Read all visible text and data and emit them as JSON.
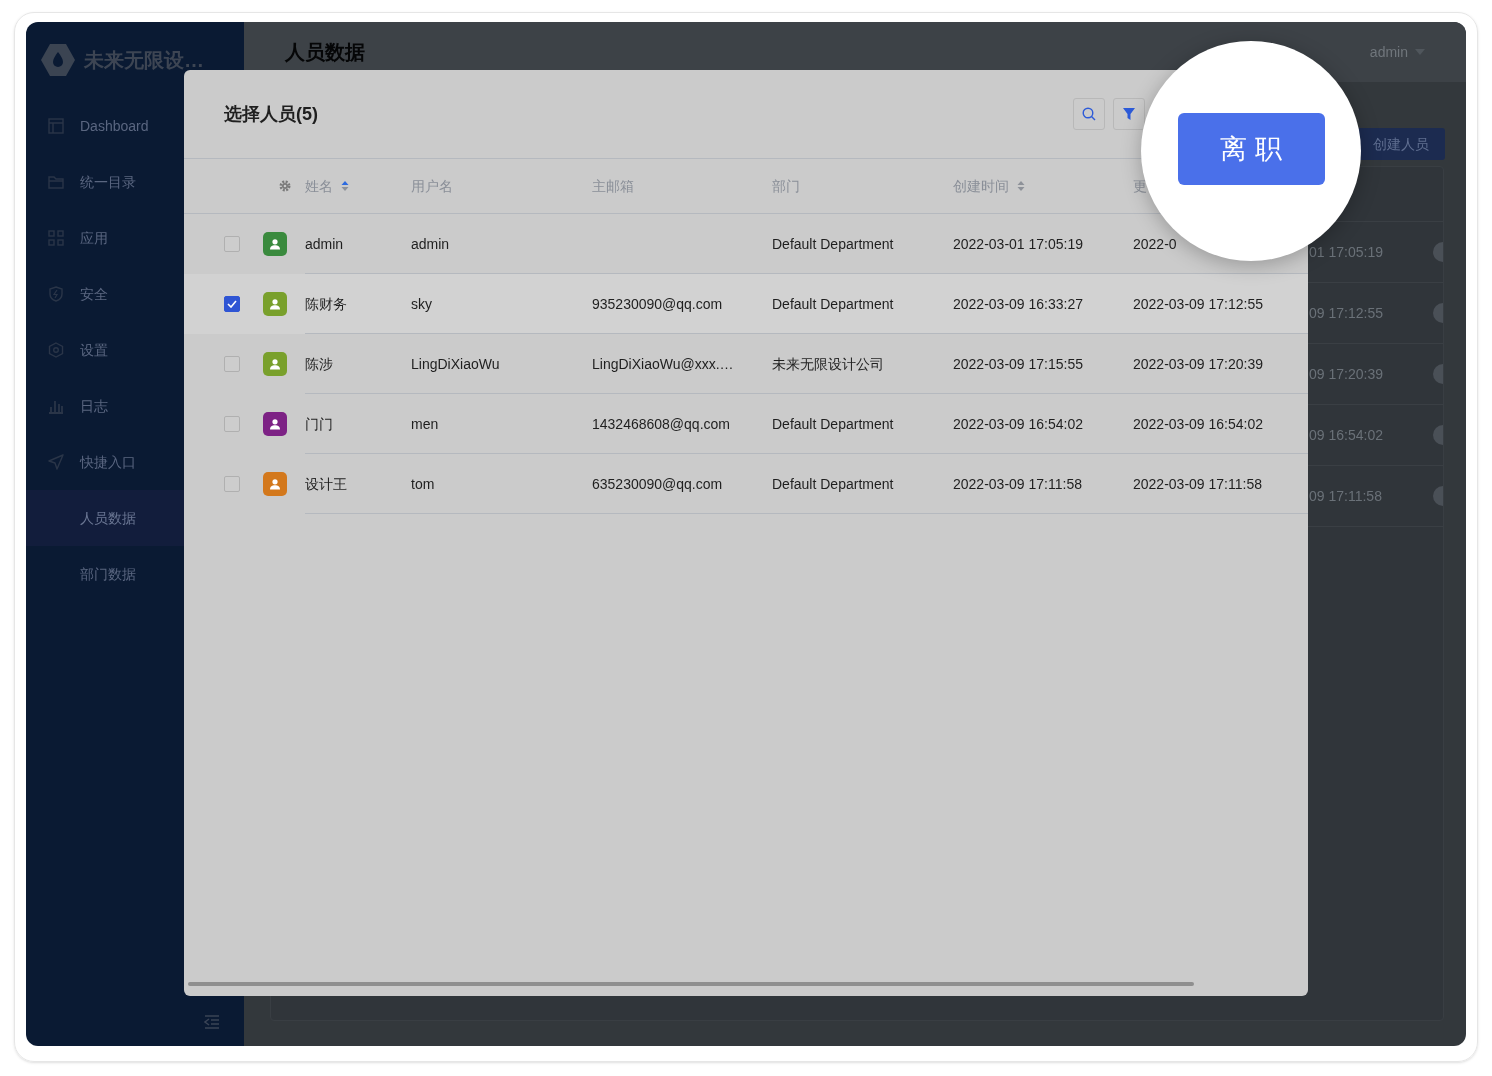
{
  "sidebar": {
    "logo_text": "未来无限设…",
    "items": [
      {
        "label": "Dashboard",
        "selected": false
      },
      {
        "label": "统一目录",
        "selected": false
      },
      {
        "label": "应用",
        "selected": false
      },
      {
        "label": "安全",
        "selected": false
      },
      {
        "label": "设置",
        "selected": false
      },
      {
        "label": "日志",
        "selected": false
      },
      {
        "label": "快捷入口",
        "selected": false,
        "children": [
          {
            "label": "人员数据",
            "selected": true
          },
          {
            "label": "部门数据",
            "selected": false
          }
        ]
      }
    ]
  },
  "page": {
    "title": "人员数据",
    "user": "admin",
    "create_button": "创建人员",
    "row_fragments": [
      "01 17:05:19",
      "09 17:12:55",
      "09 17:20:39",
      "09 16:54:02",
      "09 17:11:58"
    ]
  },
  "modal": {
    "title": "选择人员(5)",
    "columns": [
      {
        "label": "姓名",
        "sorted": true
      },
      {
        "label": "用户名"
      },
      {
        "label": "主邮箱"
      },
      {
        "label": "部门"
      },
      {
        "label": "创建时间",
        "sorted": false
      },
      {
        "label": "更"
      }
    ],
    "rows": [
      {
        "selected": false,
        "color": "#3a8a3e",
        "name": "admin",
        "username": "admin",
        "email": "",
        "department": "Default Department",
        "created": "2022-03-01 17:05:19",
        "updated": "2022-0"
      },
      {
        "selected": true,
        "color": "#79a02c",
        "name": "陈财务",
        "username": "sky",
        "email": "935230090@qq.com",
        "department": "Default Department",
        "created": "2022-03-09 16:33:27",
        "updated": "2022-03-09 17:12:55"
      },
      {
        "selected": false,
        "color": "#79a02c",
        "name": "陈涉",
        "username": "LingDiXiaoWu",
        "email": "LingDiXiaoWu@xxx.…",
        "department": "未来无限设计公司",
        "created": "2022-03-09 17:15:55",
        "updated": "2022-03-09 17:20:39"
      },
      {
        "selected": false,
        "color": "#7d2285",
        "name": "门门",
        "username": "men",
        "email": "1432468608@qq.com",
        "department": "Default Department",
        "created": "2022-03-09 16:54:02",
        "updated": "2022-03-09 16:54:02"
      },
      {
        "selected": false,
        "color": "#d3781c",
        "name": "设计王",
        "username": "tom",
        "email": "635230090@qq.com",
        "department": "Default Department",
        "created": "2022-03-09 17:11:58",
        "updated": "2022-03-09 17:11:58"
      }
    ],
    "action_button": "离 职"
  }
}
